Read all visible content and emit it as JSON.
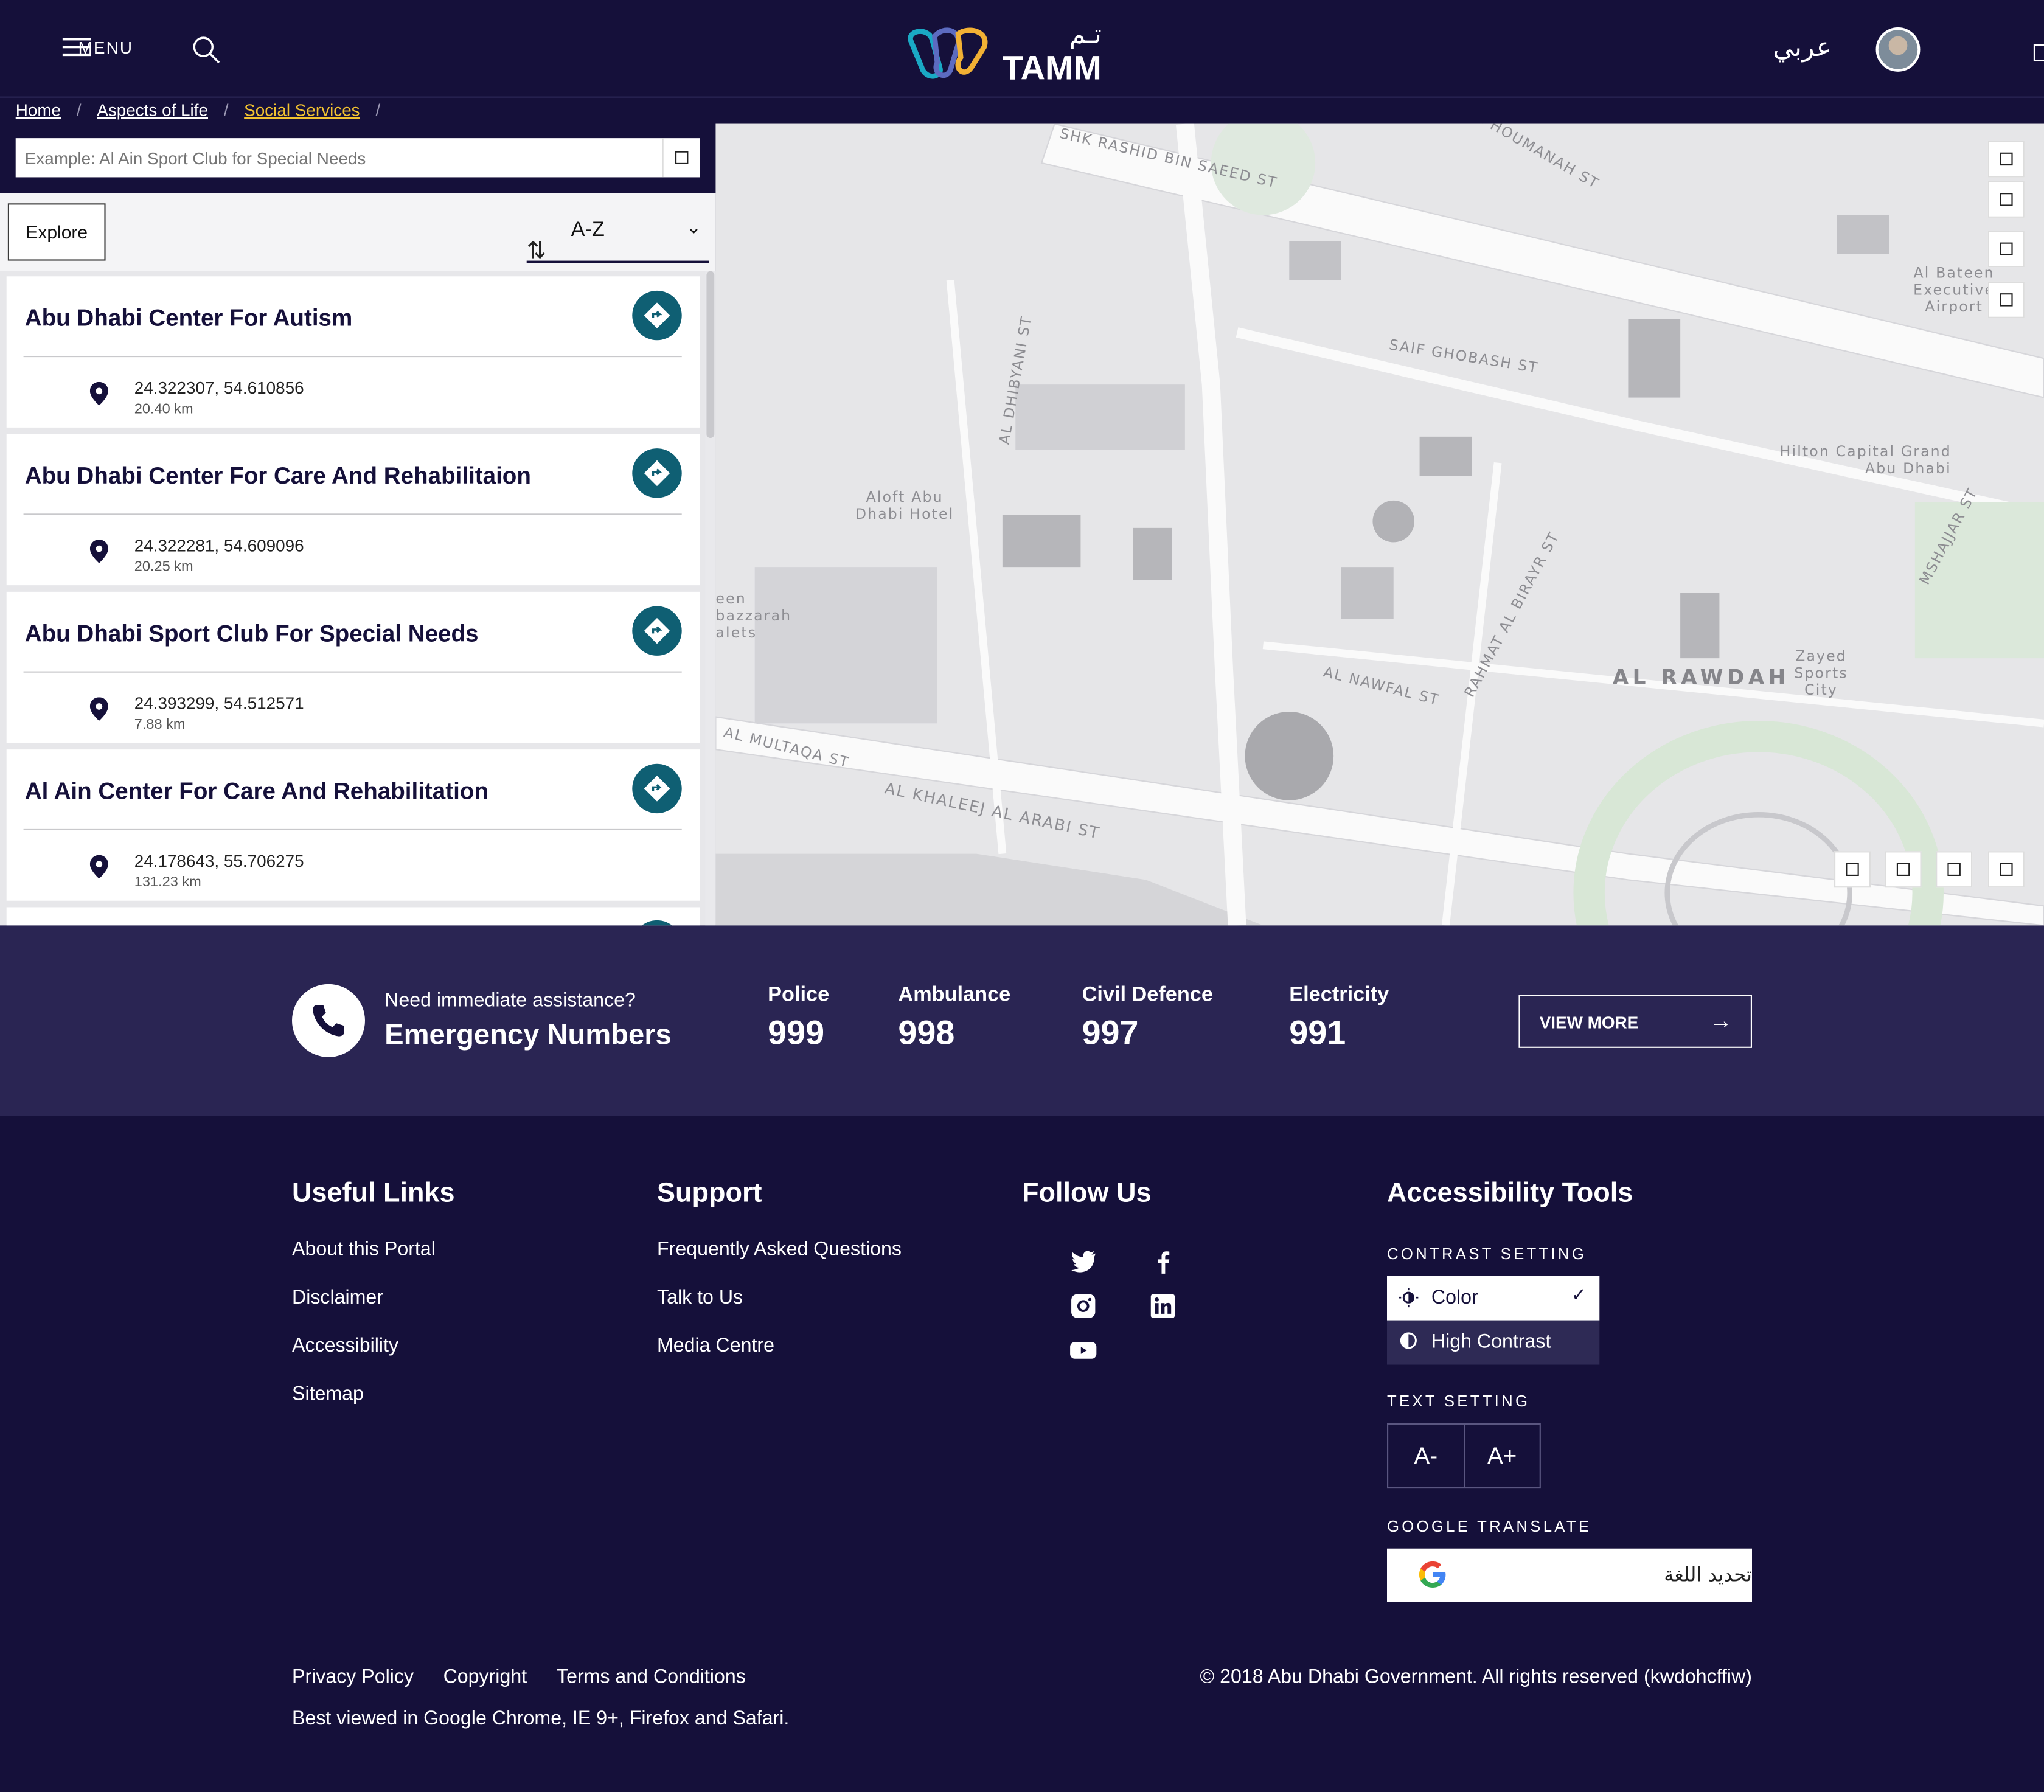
{
  "header": {
    "menu_label": "MENU",
    "logo_text": "TAMM",
    "logo_arabic": "تـم",
    "language_toggle": "عربي"
  },
  "breadcrumb": [
    "Home",
    "Aspects of Life",
    "Social Services"
  ],
  "search": {
    "placeholder": "Example: Al Ain Sport Club for Special Needs"
  },
  "toolbar": {
    "explore_label": "Explore",
    "sort_value": "A-Z"
  },
  "centers": [
    {
      "name": "Abu Dhabi Center For Autism",
      "coords": "24.322307, 54.610856",
      "distance": "20.40 km"
    },
    {
      "name": "Abu Dhabi Center For Care And Rehabilitaion",
      "coords": "24.322281, 54.609096",
      "distance": "20.25 km"
    },
    {
      "name": "Abu Dhabi Sport Club For Special Needs",
      "coords": "24.393299, 54.512571",
      "distance": "7.88 km"
    },
    {
      "name": "Al Ain Center For Care And Rehabilitation",
      "coords": "24.178643, 55.706275",
      "distance": "131.23 km"
    }
  ],
  "map": {
    "labels": {
      "shk_rashid": "SHK RASHID BIN SAEED ST",
      "saif_ghobash": "SAIF GHOBASH ST",
      "al_dhibyani": "AL DHIBYANI ST",
      "aloft": "Aloft Abu Dhabi Hotel",
      "al_bateen": "Al Bateen Executive Airport",
      "hilton": "Hilton Capital Grand Abu Dhabi",
      "al_rawdah": "AL RAWDAH",
      "zayed_sports": "Zayed Sports City",
      "al_nawfal": "AL NAWFAL ST",
      "rahmat": "RAHMAT AL BIRAYR ST",
      "al_multaqa": "AL MULTAQA ST",
      "al_khaleej": "AL KHALEEJ AL ARABI ST",
      "bazzarah": "een bazzarah alets",
      "mshajjar": "MSHAJJAR ST",
      "houmanah": "AL HOUMANAH ST"
    }
  },
  "emergency": {
    "prompt": "Need immediate assistance?",
    "title": "Emergency Numbers",
    "numbers": [
      {
        "label": "Police",
        "value": "999"
      },
      {
        "label": "Ambulance",
        "value": "998"
      },
      {
        "label": "Civil Defence",
        "value": "997"
      },
      {
        "label": "Electricity",
        "value": "991"
      }
    ],
    "view_more": "VIEW MORE"
  },
  "footer": {
    "useful_links": {
      "title": "Useful Links",
      "items": [
        "About this Portal",
        "Disclaimer",
        "Accessibility",
        "Sitemap"
      ]
    },
    "support": {
      "title": "Support",
      "items": [
        "Frequently Asked Questions",
        "Talk to Us",
        "Media Centre"
      ]
    },
    "follow": {
      "title": "Follow Us",
      "icons": [
        "twitter-icon",
        "facebook-icon",
        "instagram-icon",
        "linkedin-icon",
        "youtube-icon"
      ]
    },
    "accessibility": {
      "title": "Accessibility Tools",
      "contrast_label": "CONTRAST SETTING",
      "contrast_options": [
        "Color",
        "High Contrast"
      ],
      "text_label": "TEXT SETTING",
      "text_decrease": "A-",
      "text_increase": "A+",
      "translate_label": "GOOGLE TRANSLATE",
      "translate_text": "تحديد اللغة"
    },
    "legal": [
      "Privacy Policy",
      "Copyright",
      "Terms and Conditions"
    ],
    "best_viewed": "Best viewed in Google Chrome, IE 9+, Firefox and Safari.",
    "copyright": "© 2018 Abu Dhabi Government. All rights reserved (kwdohcffiw)"
  },
  "colors": {
    "navy": "#15103a",
    "teal": "#0f5f73",
    "breadcrumb_active": "#f2c230",
    "emergency_bg": "#2a2553"
  }
}
